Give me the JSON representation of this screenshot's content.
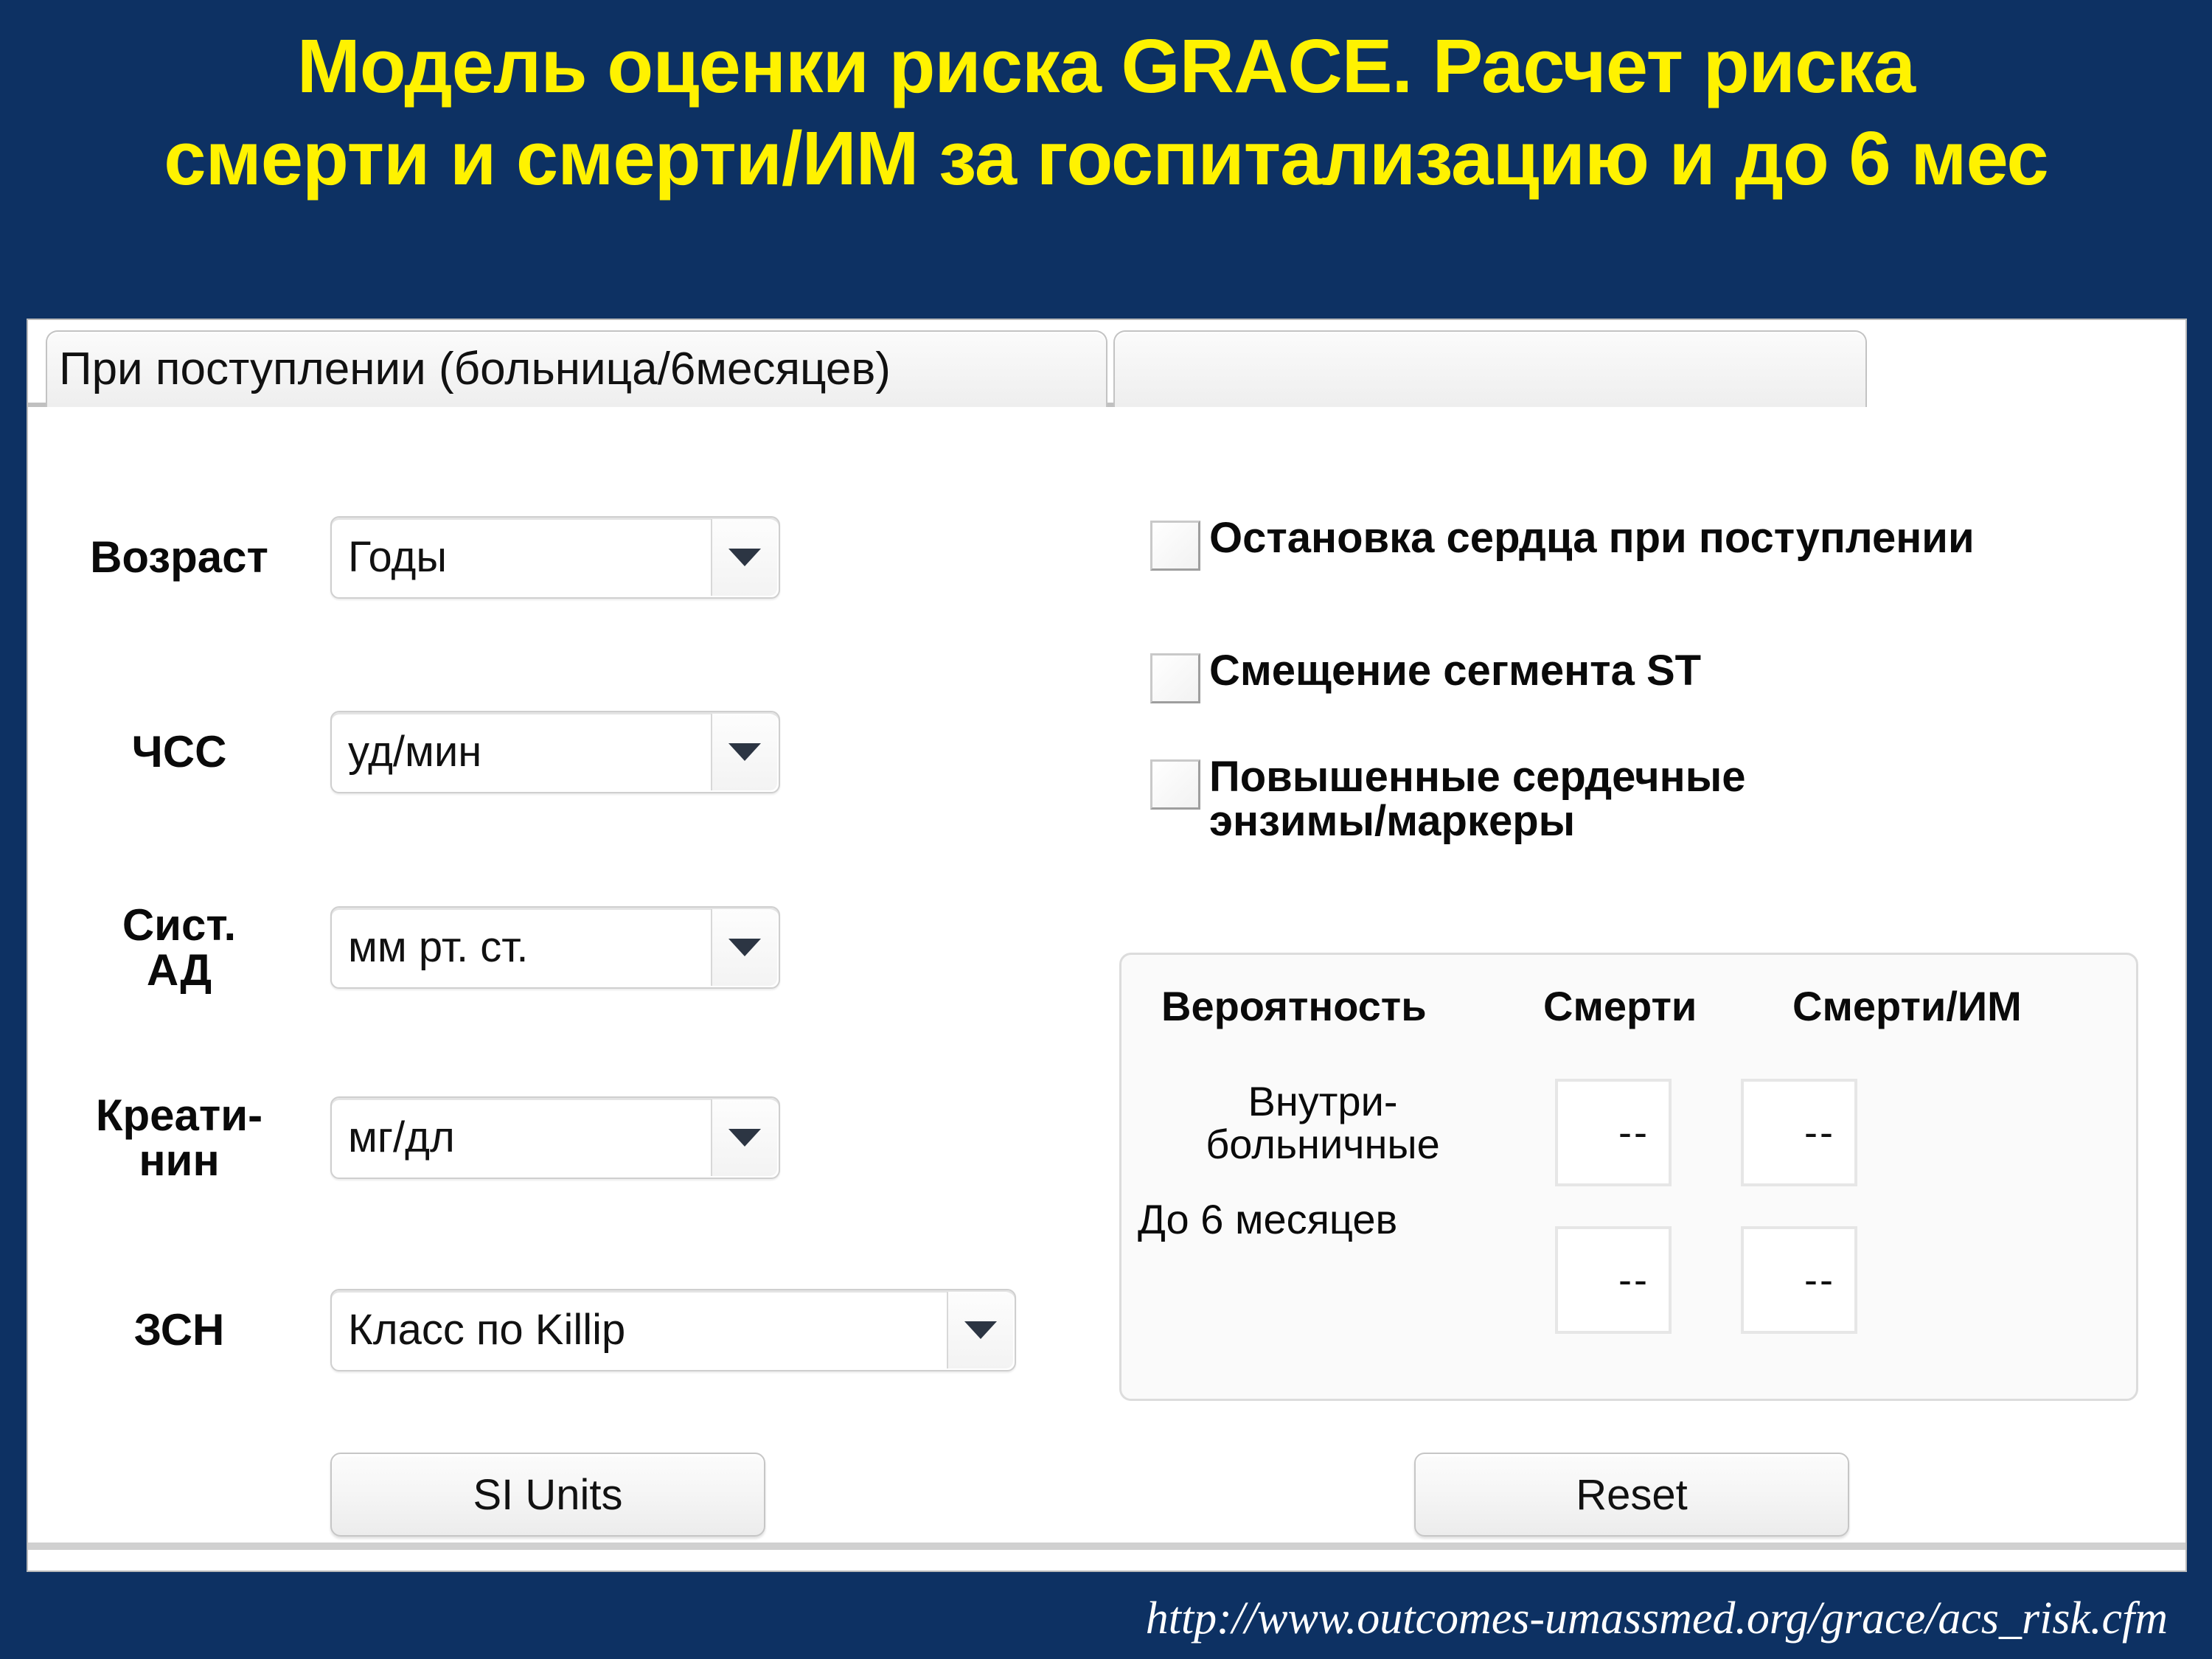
{
  "title": {
    "line1": "Модель оценки риска GRACE. Расчет риска",
    "line2": "смерти и смерти/ИМ за госпитализацию и до 6 мес",
    "color": "#FFF200"
  },
  "background_color": "#0D3163",
  "tabs": [
    {
      "label": "При поступлении (больница/6месяцев)",
      "active": true
    },
    {
      "label": "",
      "active": false
    }
  ],
  "form": {
    "fields": [
      {
        "label": "Возраст",
        "value": "Годы"
      },
      {
        "label": "ЧСС",
        "value": "уд/мин"
      },
      {
        "label": "Сист.\nАД",
        "value": "мм рт. ст."
      },
      {
        "label": "Креати-\nнин",
        "value": "мг/дл"
      },
      {
        "label": "ЗСН",
        "value": "Класс по Killip"
      }
    ],
    "si_units_label": "SI Units"
  },
  "checkboxes": [
    {
      "label": "Остановка сердца при поступлении",
      "checked": false
    },
    {
      "label": "Смещение сегмента ST",
      "checked": false
    },
    {
      "label": "Повышенные сердечные\nэнзимы/маркеры",
      "checked": false
    }
  ],
  "results": {
    "headers": {
      "probability": "Вероятность",
      "death": "Смерти",
      "death_mi": "Смерти/ИМ"
    },
    "rows": [
      {
        "label": "Внутри-\nбольничные",
        "death": "--",
        "death_mi": "--"
      },
      {
        "label": "До 6 месяцев",
        "death": "--",
        "death_mi": "--"
      }
    ]
  },
  "reset_label": "Reset",
  "footer": {
    "url": "http://www.outcomes-umassmed.org/grace/acs_risk.cfm"
  }
}
